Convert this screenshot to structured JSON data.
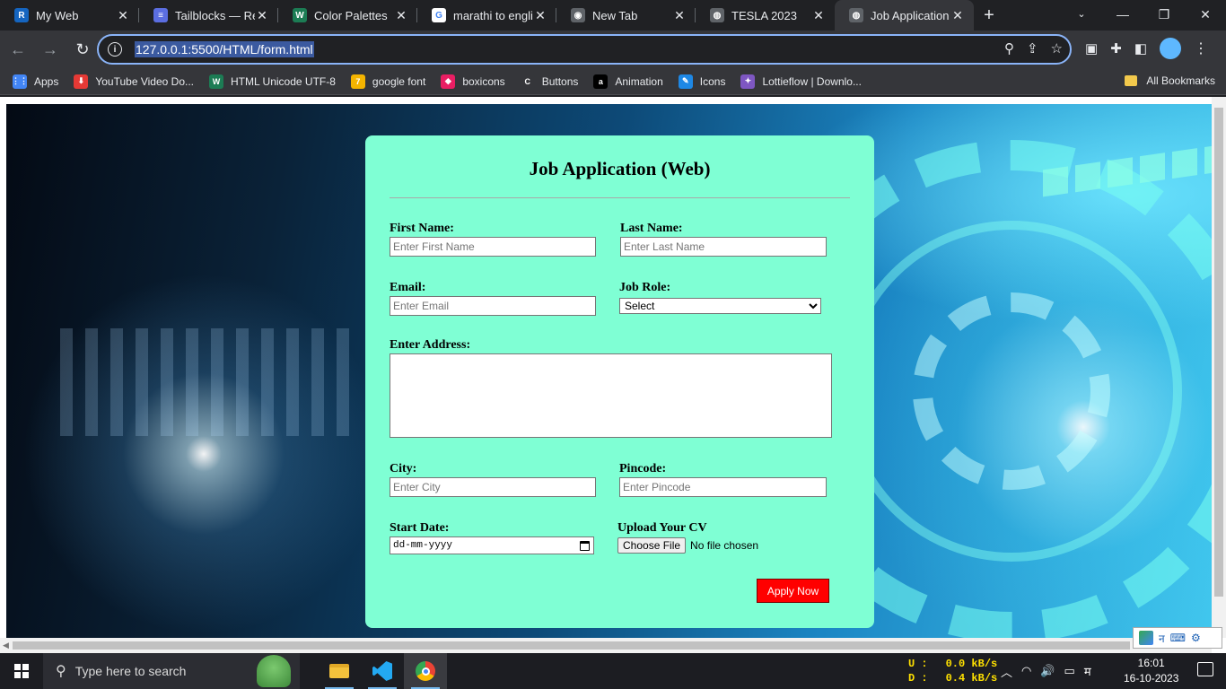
{
  "browser": {
    "tabs": [
      {
        "title": "My Web",
        "favicon": "R",
        "color": "#1565c0"
      },
      {
        "title": "Tailblocks — Rea",
        "favicon": "≡",
        "color": "#5b6ee1"
      },
      {
        "title": "Color Palettes",
        "favicon": "W",
        "color": "#1c7c54"
      },
      {
        "title": "marathi to engli",
        "favicon": "G",
        "color": "#ffffff"
      },
      {
        "title": "New Tab",
        "favicon": "◉",
        "color": "#5f6368"
      },
      {
        "title": "TESLA 2023",
        "favicon": "◍",
        "color": "#5f6368"
      },
      {
        "title": "Job Application",
        "favicon": "◍",
        "color": "#5f6368"
      }
    ],
    "url": "127.0.0.1:5500/HTML/form.html",
    "bookmarks": [
      {
        "label": "Apps",
        "icon": "⋮⋮",
        "color": "#4285f4"
      },
      {
        "label": "YouTube Video Do...",
        "icon": "⬇",
        "color": "#e53935"
      },
      {
        "label": "HTML Unicode UTF-8",
        "icon": "W",
        "color": "#1c7c54"
      },
      {
        "label": "google font",
        "icon": "7",
        "color": "#f4b400"
      },
      {
        "label": "boxicons",
        "icon": "◆",
        "color": "#e91e63"
      },
      {
        "label": "Buttons",
        "icon": "C",
        "color": "#35363a"
      },
      {
        "label": "Animation",
        "icon": "a",
        "color": "#000000"
      },
      {
        "label": "Icons",
        "icon": "✎",
        "color": "#1e88e5"
      },
      {
        "label": "Lottieflow | Downlo...",
        "icon": "✦",
        "color": "#7e57c2"
      }
    ],
    "all_bookmarks": "All Bookmarks"
  },
  "form": {
    "title": "Job Application (Web)",
    "first_name": {
      "label": "First Name:",
      "placeholder": "Enter First Name"
    },
    "last_name": {
      "label": "Last Name:",
      "placeholder": "Enter Last Name"
    },
    "email": {
      "label": "Email:",
      "placeholder": "Enter Email"
    },
    "job_role": {
      "label": "Job Role:",
      "selected": "Select"
    },
    "address": {
      "label": "Enter Address:"
    },
    "city": {
      "label": "City:",
      "placeholder": "Enter City"
    },
    "pincode": {
      "label": "Pincode:",
      "placeholder": "Enter Pincode"
    },
    "start_date": {
      "label": "Start Date:",
      "placeholder": "dd-mm-yyyy"
    },
    "cv": {
      "label": "Upload Your CV",
      "button": "Choose File",
      "status": "No file chosen"
    },
    "submit": "Apply Now",
    "card_color": "#7fffd4",
    "submit_color": "#ff0000"
  },
  "taskbar": {
    "search_placeholder": "Type here to search",
    "net_up_label": "U :",
    "net_up": "0.0 kB/s",
    "net_down_label": "D :",
    "net_down": "0.4 kB/s",
    "lang": "म",
    "time": "16:01",
    "date": "16-10-2023"
  }
}
